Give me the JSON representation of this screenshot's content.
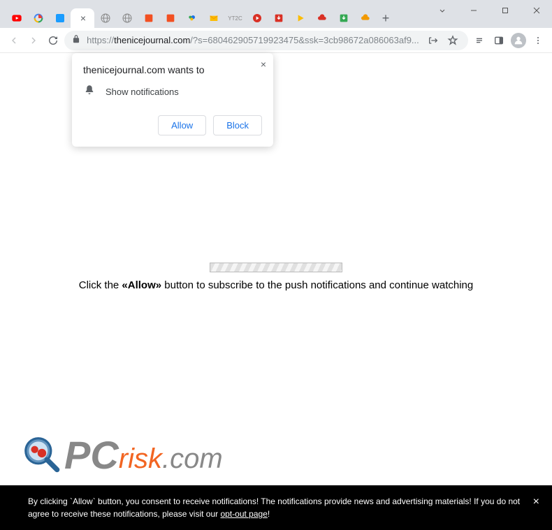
{
  "window": {
    "tabs": [
      {
        "name": "youtube",
        "color": "#ff0000"
      },
      {
        "name": "google"
      },
      {
        "name": "app-blue",
        "color": "#1a73e8"
      },
      {
        "name": "active",
        "active": true
      },
      {
        "name": "globe",
        "color": "#6b7280"
      },
      {
        "name": "globe2",
        "color": "#6b7280"
      },
      {
        "name": "app-orange",
        "color": "#f25022"
      },
      {
        "name": "app-orange2",
        "color": "#f25022"
      },
      {
        "name": "cloud",
        "color": "#34a853"
      },
      {
        "name": "mail",
        "color": "#fbbc04"
      },
      {
        "name": "yt2c",
        "color": "#888"
      },
      {
        "name": "play-red",
        "color": "#d93025"
      },
      {
        "name": "down-red",
        "color": "#d93025"
      },
      {
        "name": "play-yellow",
        "color": "#fbbc04"
      },
      {
        "name": "cloud-red",
        "color": "#d93025"
      },
      {
        "name": "down-green",
        "color": "#34a853"
      },
      {
        "name": "cloud-orange",
        "color": "#f29900"
      }
    ],
    "newtab": "+"
  },
  "url": {
    "scheme": "https://",
    "host": "thenicejournal.com",
    "path": "/?s=680462905719923475&ssk=3cb98672a086063af9..."
  },
  "prompt": {
    "title": "thenicejournal.com wants to",
    "text": "Show notifications",
    "allow": "Allow",
    "block": "Block",
    "close": "×"
  },
  "page": {
    "msg_pre": "Click the ",
    "msg_bold": "«Allow»",
    "msg_post": " button to subscribe to the push notifications and continue watching"
  },
  "logo": {
    "pc": "PC",
    "risk": "risk",
    "dotcom": ".com"
  },
  "consent": {
    "text1": "By clicking `Allow` button, you consent to receive notifications! The notifications provide news and advertising materials! If you do not agree to receive these notifications, please visit our ",
    "opt": "opt-out page",
    "text2": "!",
    "close": "×"
  }
}
